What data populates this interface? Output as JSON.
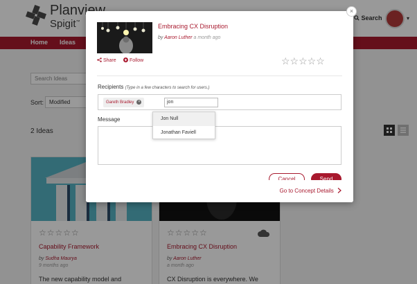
{
  "app": {
    "brand": "Planview",
    "brand_sub": "Spigit",
    "brand_mark": "™",
    "search_label": "Search",
    "nav": [
      "Home",
      "Ideas"
    ]
  },
  "page": {
    "search_placeholder": "Search Ideas",
    "sort_label": "Sort:",
    "sort_value": "Modified",
    "ideas_count": "2 Ideas",
    "cards": [
      {
        "title": "Capability Framework",
        "by_prefix": "by",
        "author": "Sudha Maurya",
        "time": "9 months ago",
        "desc": "The new capability model and"
      },
      {
        "title": "Embracing CX Disruption",
        "by_prefix": "by",
        "author": "Aaron Luther",
        "time": "a month ago",
        "desc": "CX Disruption is everywhere. We"
      }
    ]
  },
  "modal": {
    "close_glyph": "×",
    "title": "Embracing CX Disruption",
    "by_prefix": "by",
    "author": "Aaron Luther",
    "ago": "a month ago",
    "share_label": "Share",
    "follow_label": "Follow",
    "rating_stars": "☆☆☆☆☆",
    "recipients_label": "Recipients",
    "recipients_hint": "(Type in a few characters to search for users.)",
    "recipient_tag": "Gareth Bradley",
    "recipient_input": "jon",
    "suggestions": [
      "Jon Null",
      "Jonathan Faviell"
    ],
    "message_label": "Message",
    "message_value": "",
    "cancel_label": "Cancel",
    "send_label": "Send",
    "concept_link": "Go to Concept Details"
  },
  "colors": {
    "accent": "#a8192e",
    "overlay": "rgba(0,0,0,0.40)"
  },
  "icons": [
    "logo-icon",
    "share-icon",
    "follow-plus-icon",
    "close-icon",
    "chevron-right-icon",
    "grid-view-icon",
    "list-view-icon",
    "cloud-icon"
  ]
}
